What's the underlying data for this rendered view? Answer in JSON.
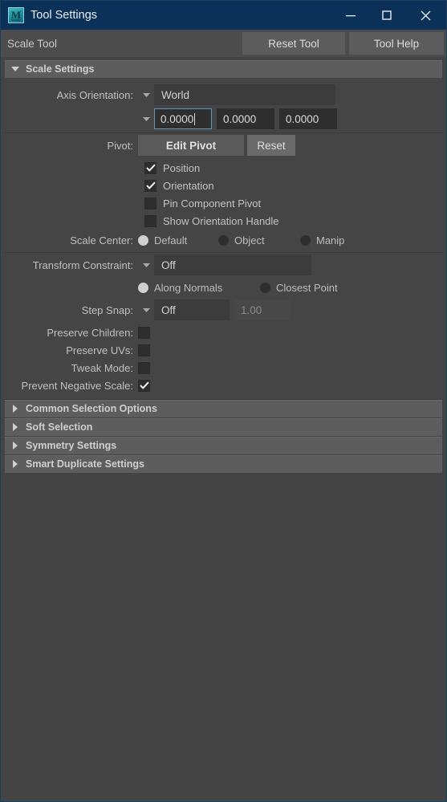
{
  "window": {
    "title": "Tool Settings",
    "logo_letter": "M",
    "controls": {
      "minimize": "minimize-button",
      "maximize": "maximize-button",
      "close": "close-button"
    }
  },
  "toolbar": {
    "tool_name": "Scale Tool",
    "reset_tool_label": "Reset Tool",
    "tool_help_label": "Tool Help"
  },
  "sections": {
    "scale_settings": {
      "title": "Scale Settings",
      "expanded": true
    },
    "collapsed": [
      {
        "title": "Common Selection Options"
      },
      {
        "title": "Soft Selection"
      },
      {
        "title": "Symmetry Settings"
      },
      {
        "title": "Smart Duplicate Settings"
      }
    ]
  },
  "scale_settings": {
    "axis_orientation": {
      "label": "Axis Orientation:",
      "value": "World",
      "fields": [
        {
          "value": "0.0000",
          "focused": true
        },
        {
          "value": "0.0000",
          "focused": false
        },
        {
          "value": "0.0000",
          "focused": false
        }
      ]
    },
    "pivot": {
      "label": "Pivot:",
      "edit_label": "Edit Pivot",
      "reset_label": "Reset",
      "checkboxes": [
        {
          "label": "Position",
          "checked": true
        },
        {
          "label": "Orientation",
          "checked": true
        },
        {
          "label": "Pin Component Pivot",
          "checked": false
        },
        {
          "label": "Show Orientation Handle",
          "checked": false
        }
      ]
    },
    "scale_center": {
      "label": "Scale Center:",
      "options": [
        {
          "label": "Default",
          "selected": true
        },
        {
          "label": "Object",
          "selected": false
        },
        {
          "label": "Manip",
          "selected": false
        }
      ]
    },
    "transform_constraint": {
      "label": "Transform Constraint:",
      "value": "Off",
      "options": [
        {
          "label": "Along Normals",
          "selected": true
        },
        {
          "label": "Closest Point",
          "selected": false
        }
      ]
    },
    "step_snap": {
      "label": "Step Snap:",
      "value": "Off",
      "amount": "1.00",
      "amount_enabled": false
    },
    "toggles": [
      {
        "label": "Preserve Children:",
        "checked": false
      },
      {
        "label": "Preserve UVs:",
        "checked": false
      },
      {
        "label": "Tweak Mode:",
        "checked": false
      },
      {
        "label": "Prevent Negative Scale:",
        "checked": true
      }
    ]
  },
  "colors": {
    "titlebar": "#0b3158",
    "window_bg": "#444444",
    "section_header": "#5d5d5d",
    "field_bg": "#3c3c3c",
    "focus_border": "#5f97bd",
    "accent_logo": "#2f9fae"
  }
}
